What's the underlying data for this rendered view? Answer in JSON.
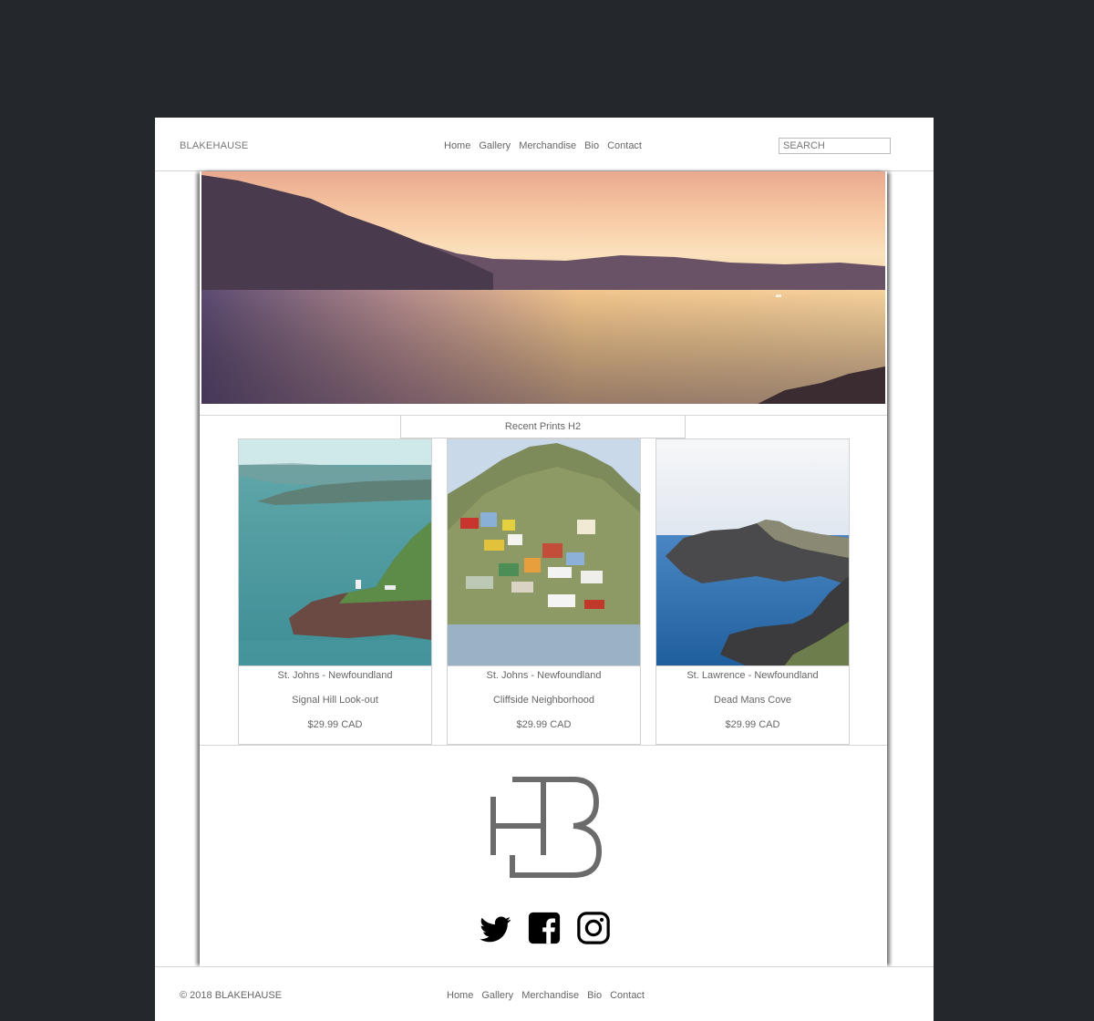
{
  "header": {
    "brand": "BLAKEHAUSE",
    "nav": [
      "Home",
      "Gallery",
      "Merchandise",
      "Bio",
      "Contact"
    ],
    "search_placeholder": "SEARCH"
  },
  "hero": {
    "icon": "sunset-landscape-image"
  },
  "section": {
    "title": "Recent Prints H2"
  },
  "products": [
    {
      "location": "St. Johns - Newfoundland",
      "name": "Signal Hill Look-out",
      "price": "$29.99 CAD"
    },
    {
      "location": "St. Johns - Newfoundland",
      "name": "Cliffside Neighborhood",
      "price": "$29.99 CAD"
    },
    {
      "location": "St. Lawrence - Newfoundland",
      "name": "Dead Mans Cove",
      "price": "$29.99 CAD"
    }
  ],
  "logo": {
    "icon": "hb-monogram-logo",
    "color": "#6b6b6b"
  },
  "social": [
    "twitter-icon",
    "facebook-icon",
    "instagram-icon"
  ],
  "footer": {
    "copyright": "© 2018 BLAKEHAUSE",
    "nav": [
      "Home",
      "Gallery",
      "Merchandise",
      "Bio",
      "Contact"
    ]
  },
  "colors": {
    "background": "#24272b",
    "page": "#ffffff",
    "text": "#666666"
  }
}
